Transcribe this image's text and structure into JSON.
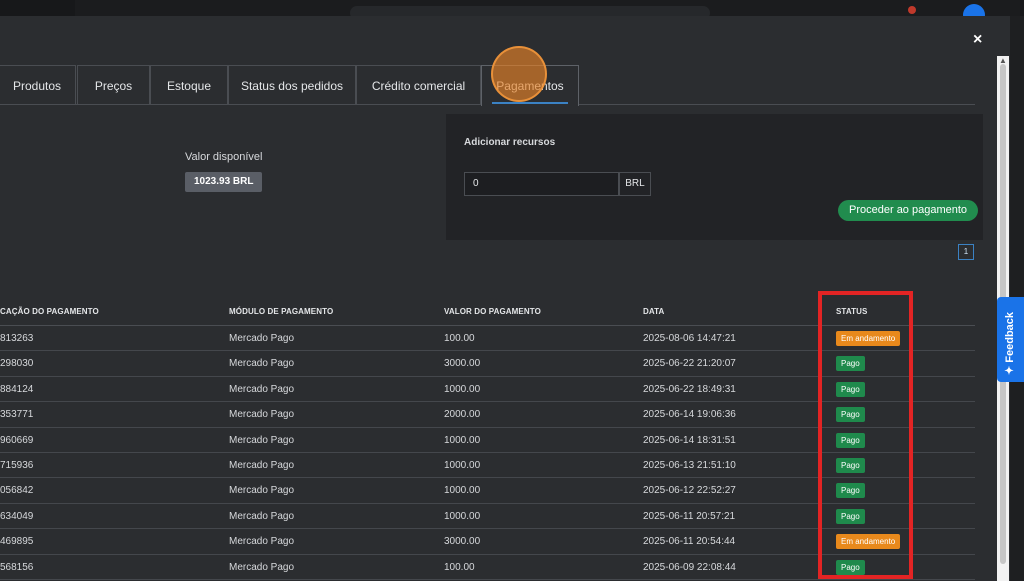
{
  "close_label": "×",
  "feedback_label": "✦ Feedback",
  "tabs": [
    {
      "label": "Produtos"
    },
    {
      "label": "Preços"
    },
    {
      "label": "Estoque"
    },
    {
      "label": "Status dos pedidos"
    },
    {
      "label": "Crédito comercial"
    },
    {
      "label": "Pagamentos"
    }
  ],
  "available": {
    "label": "Valor disponível",
    "value": "1023.93 BRL"
  },
  "add_funds": {
    "title": "Adicionar recursos",
    "amount_value": "0",
    "currency": "BRL",
    "pay_button": "Proceder ao pagamento"
  },
  "pagination": {
    "current": "1"
  },
  "table": {
    "headers": [
      "CAÇÃO DO PAGAMENTO",
      "MÓDULO DE PAGAMENTO",
      "VALOR DO PAGAMENTO",
      "DATA",
      "STATUS"
    ],
    "rows": [
      {
        "id": "813263",
        "module": "Mercado Pago",
        "value": "100.00",
        "date": "2025-08-06 14:47:21",
        "status": "Em andamento",
        "kind": "andamento"
      },
      {
        "id": "298030",
        "module": "Mercado Pago",
        "value": "3000.00",
        "date": "2025-06-22 21:20:07",
        "status": "Pago",
        "kind": "pago"
      },
      {
        "id": "884124",
        "module": "Mercado Pago",
        "value": "1000.00",
        "date": "2025-06-22 18:49:31",
        "status": "Pago",
        "kind": "pago"
      },
      {
        "id": "353771",
        "module": "Mercado Pago",
        "value": "2000.00",
        "date": "2025-06-14 19:06:36",
        "status": "Pago",
        "kind": "pago"
      },
      {
        "id": "960669",
        "module": "Mercado Pago",
        "value": "1000.00",
        "date": "2025-06-14 18:31:51",
        "status": "Pago",
        "kind": "pago"
      },
      {
        "id": "715936",
        "module": "Mercado Pago",
        "value": "1000.00",
        "date": "2025-06-13 21:51:10",
        "status": "Pago",
        "kind": "pago"
      },
      {
        "id": "056842",
        "module": "Mercado Pago",
        "value": "1000.00",
        "date": "2025-06-12 22:52:27",
        "status": "Pago",
        "kind": "pago"
      },
      {
        "id": "634049",
        "module": "Mercado Pago",
        "value": "1000.00",
        "date": "2025-06-11 20:57:21",
        "status": "Pago",
        "kind": "pago"
      },
      {
        "id": "469895",
        "module": "Mercado Pago",
        "value": "3000.00",
        "date": "2025-06-11 20:54:44",
        "status": "Em andamento",
        "kind": "andamento"
      },
      {
        "id": "568156",
        "module": "Mercado Pago",
        "value": "100.00",
        "date": "2025-06-09 22:08:44",
        "status": "Pago",
        "kind": "pago"
      }
    ]
  },
  "colors": {
    "pago": "#1f8a4c",
    "andamento": "#e8891c",
    "highlight": "#e32424",
    "accent": "#3b82c4"
  }
}
